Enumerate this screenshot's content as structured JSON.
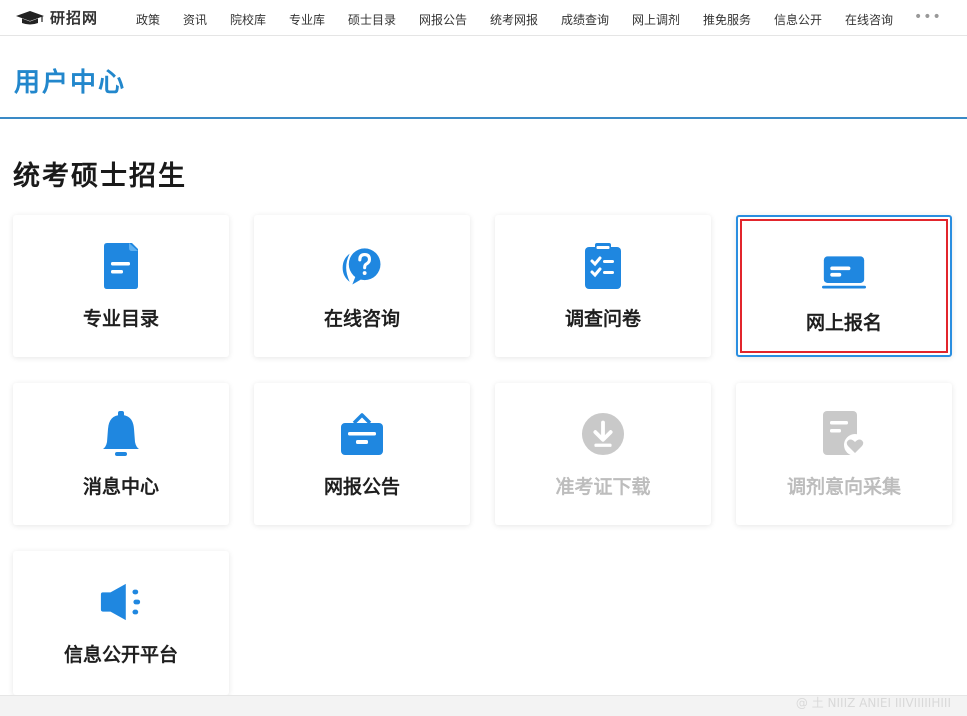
{
  "brand": {
    "name": "研招网",
    "icon": "graduation-cap-icon"
  },
  "nav": {
    "items": [
      "政策",
      "资讯",
      "院校库",
      "专业库",
      "硕士目录",
      "网报公告",
      "统考网报",
      "成绩查询",
      "网上调剂",
      "推免服务",
      "信息公开",
      "在线咨询"
    ],
    "more": "•••"
  },
  "header": {
    "title": "用户中心"
  },
  "section": {
    "title": "统考硕士招生"
  },
  "cards": [
    {
      "label": "专业目录",
      "icon": "document-list-icon",
      "enabled": true,
      "selected": false
    },
    {
      "label": "在线咨询",
      "icon": "question-chat-icon",
      "enabled": true,
      "selected": false
    },
    {
      "label": "调查问卷",
      "icon": "clipboard-check-icon",
      "enabled": true,
      "selected": false
    },
    {
      "label": "网上报名",
      "icon": "laptop-card-icon",
      "enabled": true,
      "selected": true
    },
    {
      "label": "消息中心",
      "icon": "bell-icon",
      "enabled": true,
      "selected": false
    },
    {
      "label": "网报公告",
      "icon": "notice-board-icon",
      "enabled": true,
      "selected": false
    },
    {
      "label": "准考证下载",
      "icon": "download-circle-icon",
      "enabled": false,
      "selected": false
    },
    {
      "label": "调剂意向采集",
      "icon": "form-heart-icon",
      "enabled": false,
      "selected": false
    },
    {
      "label": "信息公开平台",
      "icon": "speaker-icon",
      "enabled": true,
      "selected": false
    }
  ],
  "watermark": "@ 土 NIIIZ  ANIEI  IIIVIIIIIHIII",
  "colors": {
    "accent": "#2287cc",
    "icon_blue": "#1f87e0",
    "disabled": "#c9c9c9",
    "selected_outline": "#e2252c"
  }
}
